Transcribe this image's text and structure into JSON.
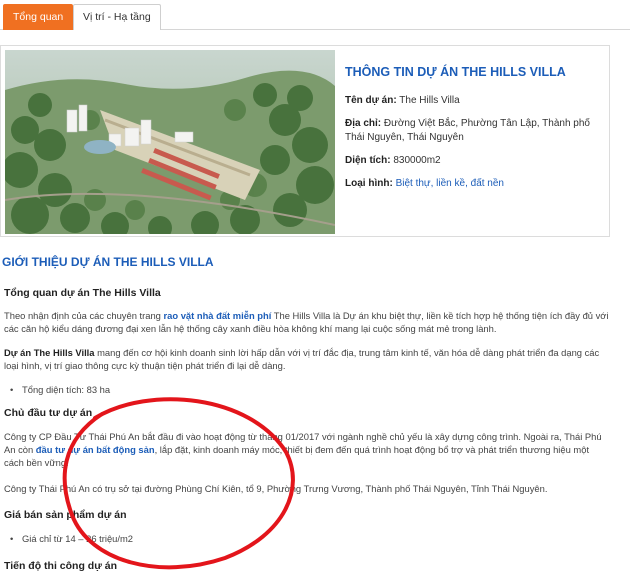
{
  "tabs": [
    {
      "label": "Tổng quan",
      "active": true
    },
    {
      "label": "Vị trí - Hạ tầng",
      "active": false
    }
  ],
  "info": {
    "title": "THÔNG TIN DỰ ÁN THE HILLS VILLA",
    "name_label": "Tên dự án:",
    "name_value": "The Hills Villa",
    "address_label": "Địa chỉ:",
    "address_value": "Đường Việt Bắc, Phường Tân Lập, Thành phố Thái Nguyên, Thái Nguyên",
    "area_label": "Diện tích:",
    "area_value": "830000m2",
    "type_label": "Loại hình:",
    "type_value": "Biệt thự, liền kề, đất nền"
  },
  "intro": {
    "title": "GIỚI THIỆU DỰ ÁN THE HILLS VILLA",
    "overview_heading": "Tổng quan dự án The Hills Villa",
    "p1_a": "Theo nhận định của các chuyên trang ",
    "p1_link": "rao vặt nhà đất miễn phí",
    "p1_b": " The Hills Villa là Dự án khu biệt thự, liền kề tích hợp hệ thống tiện ích đầy đủ với các căn hộ kiểu dáng đương đại xen lẫn hệ thống cây xanh điều hòa không khí mang lại cuộc sống mát mẻ trong lành.",
    "p2_bold": "Dự án The Hills Villa",
    "p2_rest": " mang đến cơ hội kinh doanh sinh lời hấp dẫn với vị trí đắc địa, trung tâm kinh tế, văn hóa dễ dàng phát triển đa dạng các loại hình, vị trí giao thông cực kỳ thuận tiện phát triển đi lại dễ dàng.",
    "bullet_area": "Tổng diện tích: 83 ha",
    "investor_heading": "Chủ đầu tư dự án",
    "p3_a": "Công ty CP Đầu Tư Thái Phú An bắt đầu đi vào hoạt động từ tháng 01/2017 với ngành nghề chủ yếu là xây dựng công trình. Ngoài ra, Thái Phú An còn ",
    "p3_link": "đầu tư dự án bất động sản",
    "p3_b": ", lắp đặt, kinh doanh máy móc, thiết bị đem đến quá trình hoạt động bổ trợ và phát triển thương hiệu một cách bền vững.",
    "p4": "Công ty Thái Phú An có trụ sở tại đường Phùng Chí Kiên, tổ 9, Phường Trưng Vương, Thành phố Thái Nguyên, Tỉnh Thái Nguyên.",
    "price_heading": "Giá bán sản phẩm dự án",
    "bullet_price": "Giá chỉ từ 14 – 26 triệu/m2",
    "cut_heading": "Tiến độ thi công dự án"
  },
  "colors": {
    "accent_orange": "#f07021",
    "link_blue": "#1c5db8",
    "annotation_red": "#e3151b"
  }
}
